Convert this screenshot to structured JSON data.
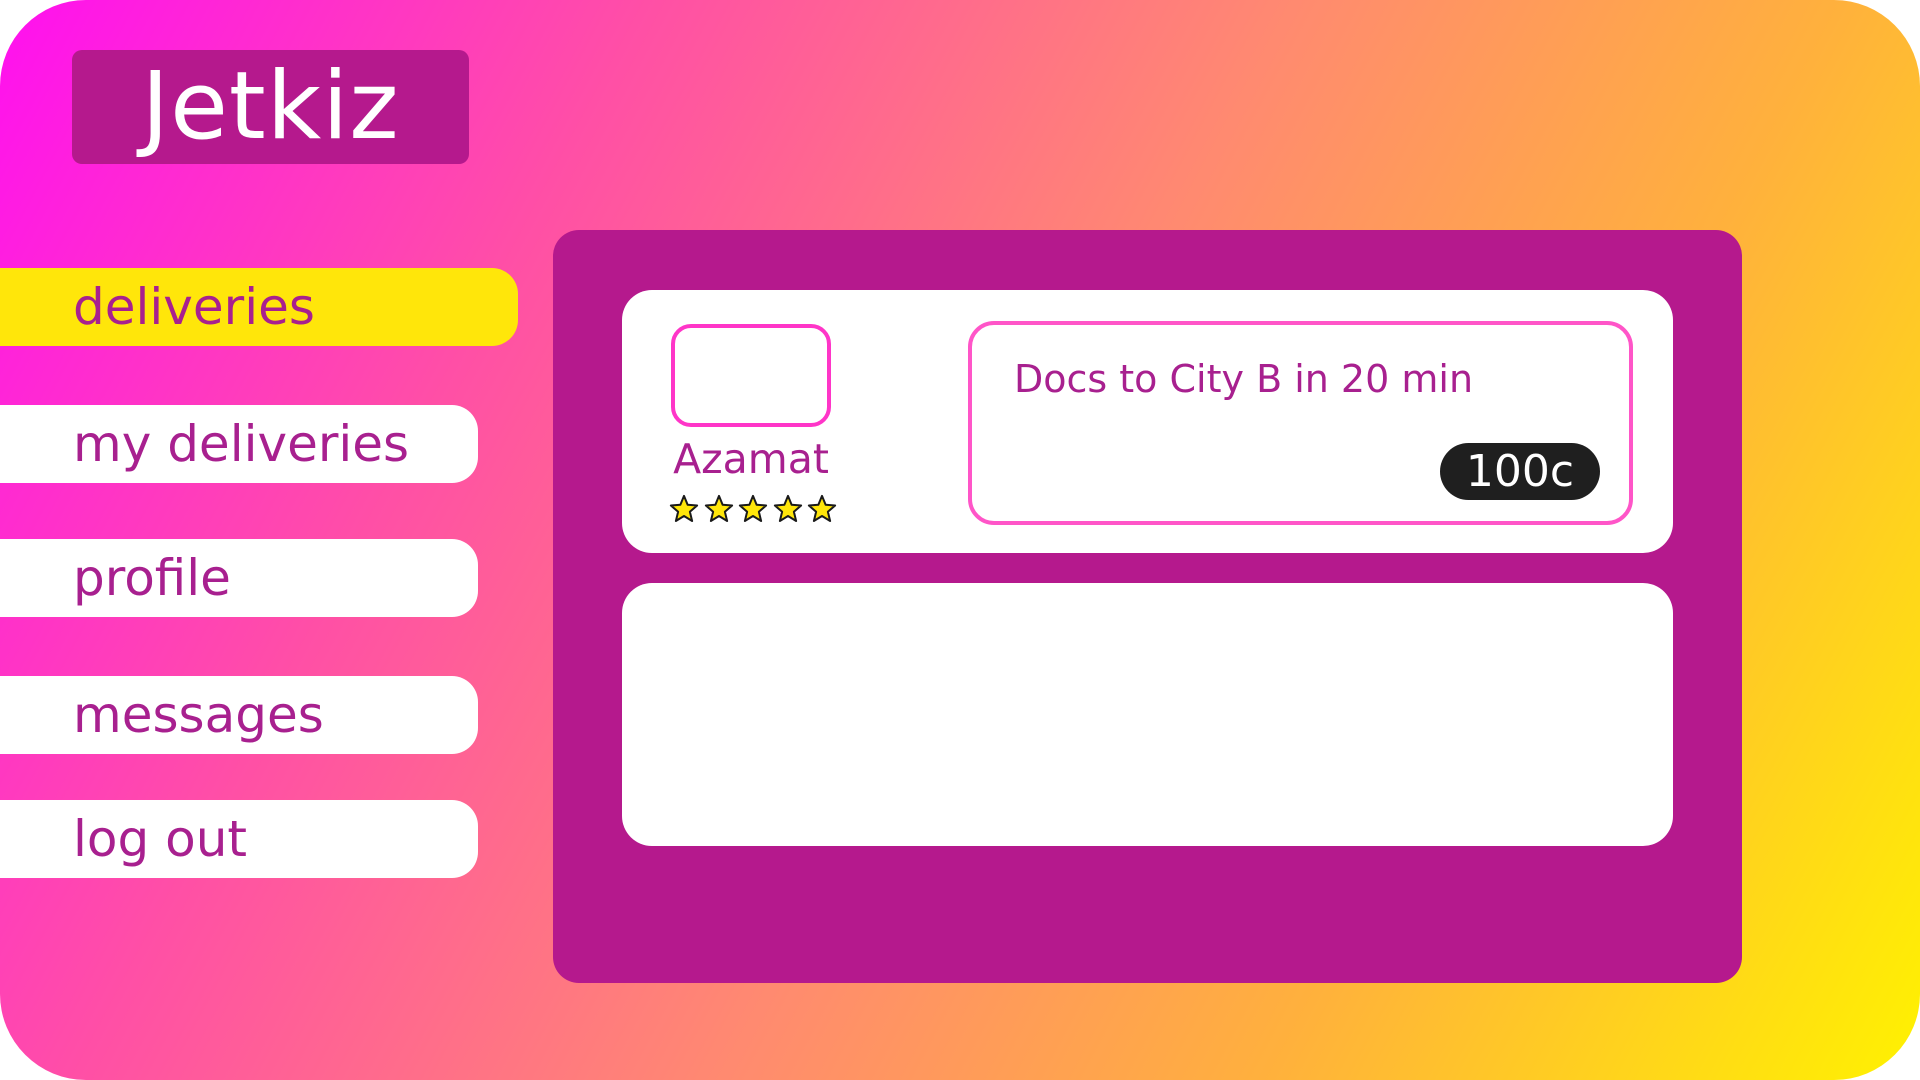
{
  "app": {
    "brand": "Jetkiz",
    "colors": {
      "accent": "#b5198d",
      "active_nav": "#ffe60a",
      "text": "#a8208f",
      "star": "#ffe60a"
    }
  },
  "sidebar": {
    "items": [
      {
        "label": "deliveries",
        "active": true
      },
      {
        "label": "my deliveries",
        "active": false
      },
      {
        "label": "profile",
        "active": false
      },
      {
        "label": "messages",
        "active": false
      },
      {
        "label": "log out",
        "active": false
      }
    ]
  },
  "main": {
    "cards": [
      {
        "user": {
          "name": "Azamat",
          "rating": 5,
          "rating_max": 5
        },
        "order": {
          "title": "Docs to City B in 20 min",
          "price": "100c"
        }
      }
    ]
  }
}
